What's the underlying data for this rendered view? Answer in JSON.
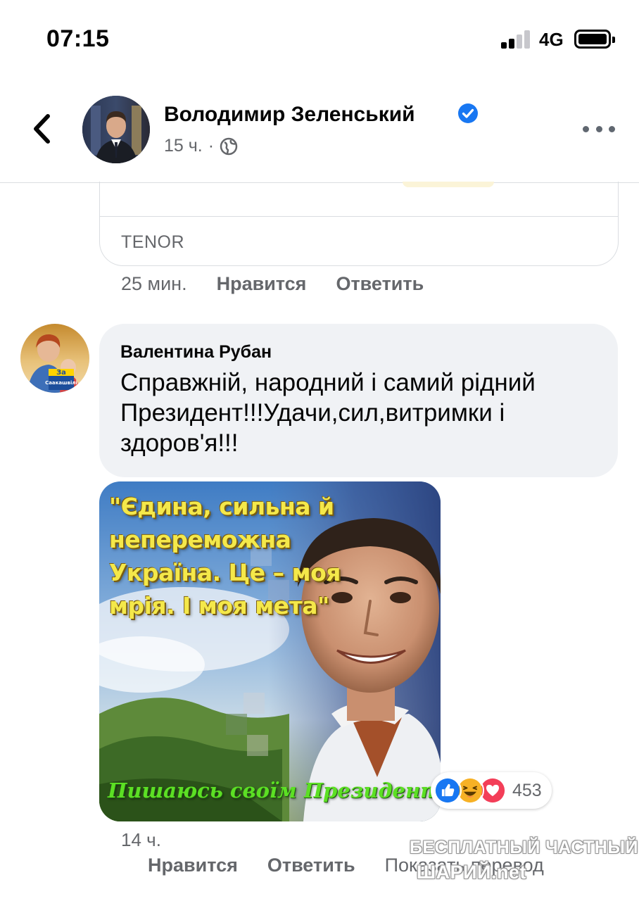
{
  "status_bar": {
    "time": "07:15",
    "network": "4G",
    "signal_bars": 2,
    "signal_bars_total": 4,
    "battery_level": 1.0
  },
  "header": {
    "back_icon": "chevron-left-icon",
    "author_name": "Володимир Зеленський",
    "verified_icon": "verified-badge-icon",
    "post_age": "15 ч.",
    "separator": "·",
    "audience_icon": "globe-icon",
    "more_icon": "more-horizontal-icon"
  },
  "link_preview": {
    "source": "TENOR"
  },
  "previous_comment": {
    "time": "25 мин.",
    "like_label": "Нравится",
    "reply_label": "Ответить"
  },
  "comment": {
    "author": "Валентина Рубан",
    "avatar_badge_line1": "За",
    "avatar_badge_line2": "Саакашвілі",
    "text": "Справжній, народний і самий рідний Президент!!!Удачи,сил,витримки і здоров'я!!!",
    "image_quote": "\"Єдина, сильна й непереможна Україна. Це – моя мрія. І моя мета\"",
    "image_caption": "Пишаюсь своїм Президентом !",
    "reactions": {
      "icons": [
        "like-icon",
        "haha-icon",
        "love-icon"
      ],
      "count": "453",
      "colors": {
        "like": "#1877f2",
        "haha": "#f7b125",
        "love": "#f33e58"
      }
    },
    "time": "14 ч.",
    "like_label": "Нравится",
    "reply_label": "Ответить",
    "translate_label": "Показать перевод"
  },
  "watermark": {
    "line1": "БЕСПЛАТНЫЙ ЧАСТНЫЙ",
    "line2": "ШАРИЙ.net"
  },
  "colors": {
    "secondary_text": "#65676b",
    "bubble_bg": "#f0f2f5",
    "verified_blue": "#1877f2"
  }
}
